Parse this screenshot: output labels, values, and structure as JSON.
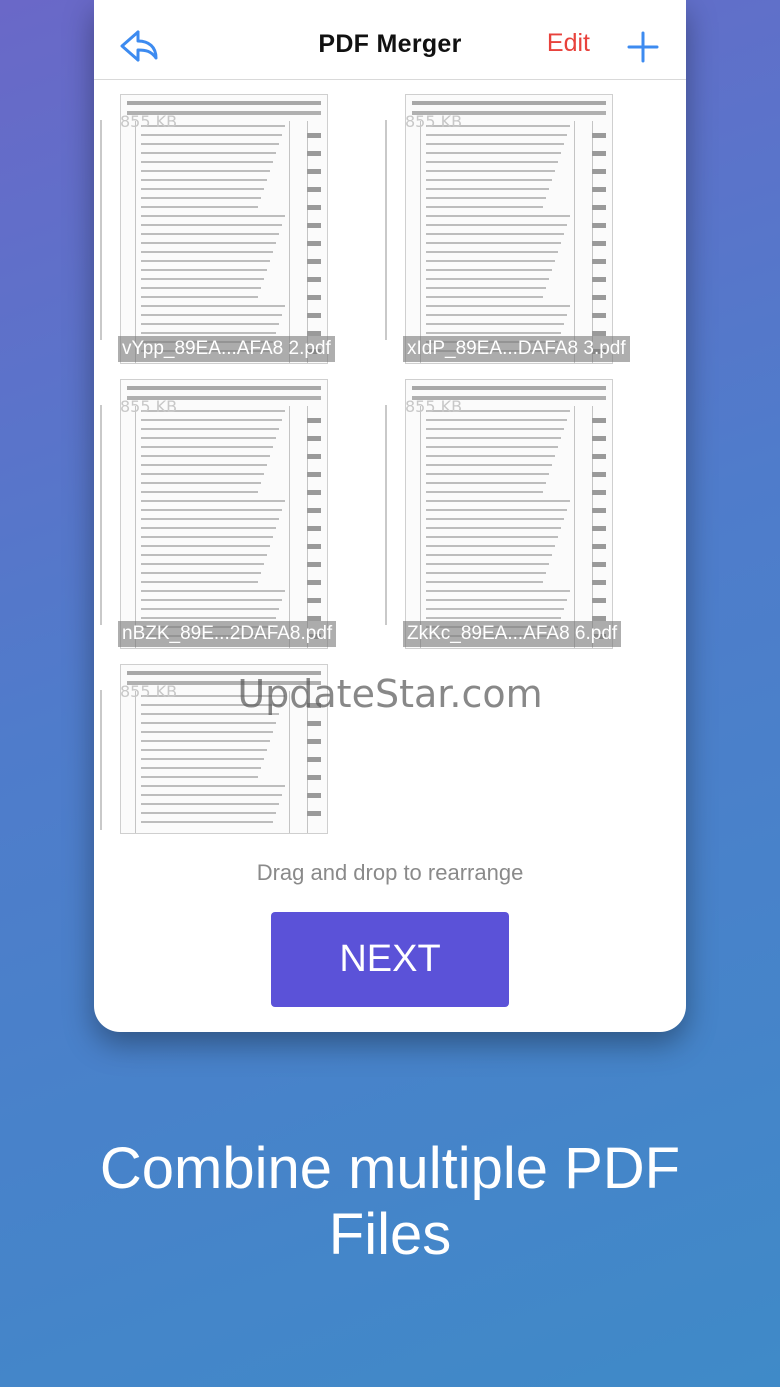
{
  "nav": {
    "title": "PDF Merger",
    "edit_label": "Edit",
    "accent_blue": "#3d8bf0",
    "accent_red": "#e8423c"
  },
  "files": [
    {
      "name": "vYpp_89EA...AFA8 2.pdf",
      "size": "855 KB"
    },
    {
      "name": "xIdP_89EA...DAFA8 3.pdf",
      "size": "855 KB"
    },
    {
      "name": "nBZK_89E...2DAFA8.pdf",
      "size": "855 KB"
    },
    {
      "name": "ZkKc_89EA...AFA8 6.pdf",
      "size": "855 KB"
    },
    {
      "name": "",
      "size": "855 KB"
    }
  ],
  "watermark": "UpdateStar.com",
  "hint": "Drag and drop to rearrange",
  "next_label": "NEXT",
  "caption": "Combine multiple PDF Files"
}
